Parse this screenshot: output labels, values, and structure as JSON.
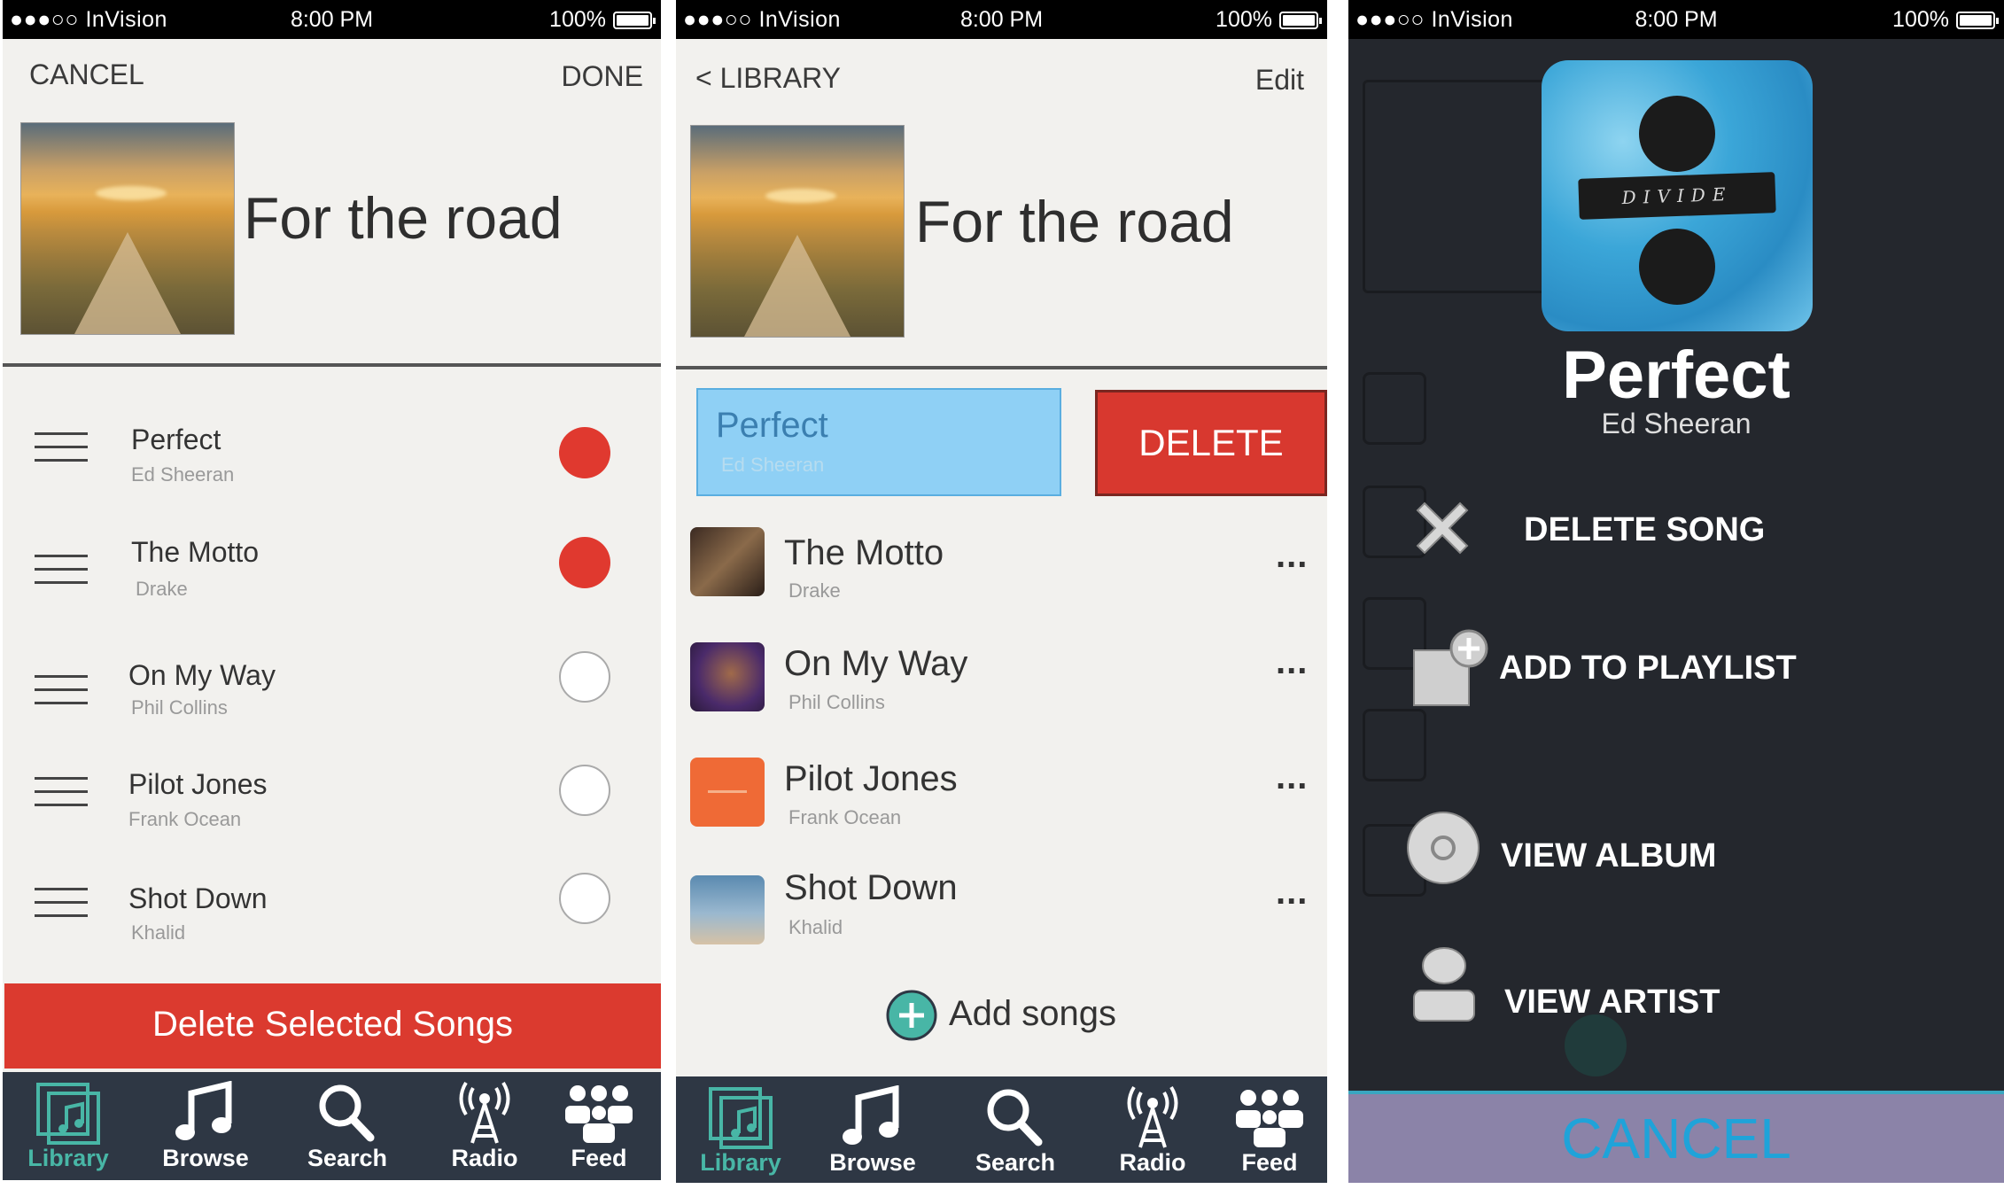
{
  "status": {
    "carrier": "●●●○○ InVision",
    "time": "8:00 PM",
    "battery": "100%"
  },
  "screen1": {
    "cancel": "CANCEL",
    "done": "DONE",
    "playlist_title": "For the road",
    "songs": [
      {
        "title": "Perfect",
        "artist": "Ed Sheeran",
        "selected": true
      },
      {
        "title": "The Motto",
        "artist": "Drake",
        "selected": true
      },
      {
        "title": "On My Way",
        "artist": "Phil Collins",
        "selected": false
      },
      {
        "title": "Pilot Jones",
        "artist": "Frank Ocean",
        "selected": false
      },
      {
        "title": "Shot Down",
        "artist": "Khalid",
        "selected": false
      }
    ],
    "delete_selected": "Delete Selected Songs"
  },
  "screen2": {
    "back": "< LIBRARY",
    "edit": "Edit",
    "playlist_title": "For the road",
    "swiped_song": {
      "title": "Perfect",
      "artist": "Ed Sheeran"
    },
    "delete_label": "DELETE",
    "songs": [
      {
        "title": "The Motto",
        "artist": "Drake",
        "more": "..."
      },
      {
        "title": "On My Way",
        "artist": "Phil Collins",
        "more": "..."
      },
      {
        "title": "Pilot Jones",
        "artist": "Frank Ocean",
        "more": "..."
      },
      {
        "title": "Shot Down",
        "artist": "Khalid",
        "more": "..."
      }
    ],
    "add_songs": "Add songs"
  },
  "screen3": {
    "album_text": "DIVIDE",
    "song_title": "Perfect",
    "song_artist": "Ed Sheeran",
    "menu": {
      "delete": "DELETE SONG",
      "add": "ADD TO PLAYLIST",
      "album": "VIEW ALBUM",
      "artist": "VIEW ARTIST"
    },
    "cancel": "CANCEL"
  },
  "tabs": [
    {
      "label": "Library",
      "icon": "library-icon",
      "active": true
    },
    {
      "label": "Browse",
      "icon": "music-note-icon",
      "active": false
    },
    {
      "label": "Search",
      "icon": "search-icon",
      "active": false
    },
    {
      "label": "Radio",
      "icon": "radio-tower-icon",
      "active": false
    },
    {
      "label": "Feed",
      "icon": "people-icon",
      "active": false
    }
  ],
  "colors": {
    "accent": "#48b6a6",
    "danger": "#db3a2f",
    "selection": "#8fd0f5",
    "tabbar": "#2e3744",
    "overlay": "#24272d",
    "cancel_bar": "#8b83a8",
    "cancel_text": "#1fa3d9"
  }
}
